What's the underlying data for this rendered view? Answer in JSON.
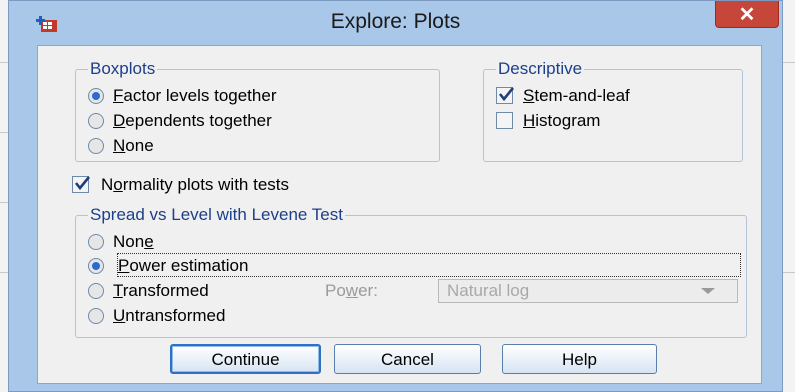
{
  "window": {
    "title": "Explore: Plots",
    "close_label": "✕"
  },
  "boxplots": {
    "legend": "Boxplots",
    "options": [
      {
        "label": "Factor levels together",
        "mnemonic": "F",
        "rest": "actor levels together",
        "selected": true
      },
      {
        "label": "Dependents together",
        "mnemonic": "D",
        "rest": "ependents together",
        "selected": false
      },
      {
        "label": "None",
        "mnemonic": "N",
        "rest": "one",
        "selected": false
      }
    ]
  },
  "descriptive": {
    "legend": "Descriptive",
    "stem_leaf": {
      "mnemonic": "S",
      "rest": "tem-and-leaf",
      "checked": true
    },
    "histogram": {
      "mnemonic": "H",
      "rest": "istogram",
      "checked": false
    }
  },
  "normality": {
    "pre": "N",
    "mnemonic": "o",
    "rest": "rmality plots with tests",
    "checked": true
  },
  "spread": {
    "legend": "Spread vs Level with Levene Test",
    "none": {
      "pre": "Non",
      "mnemonic": "e",
      "selected": false
    },
    "power_estimation": {
      "mnemonic": "P",
      "rest": "ower estimation",
      "selected": true
    },
    "transformed": {
      "mnemonic": "T",
      "rest": "ransformed",
      "selected": false
    },
    "untransformed": {
      "mnemonic": "U",
      "rest": "ntransformed",
      "selected": false
    },
    "power_label_pre": "Po",
    "power_label_mnemonic": "w",
    "power_label_rest": "er:",
    "power_value": "Natural log"
  },
  "buttons": {
    "continue": "Continue",
    "cancel": "Cancel",
    "help": "Help"
  },
  "colors": {
    "frame": "#a9c7e8",
    "close": "#c7463a",
    "legend_text": "#1c3f8a",
    "radio_on": "#2a6bd1"
  }
}
